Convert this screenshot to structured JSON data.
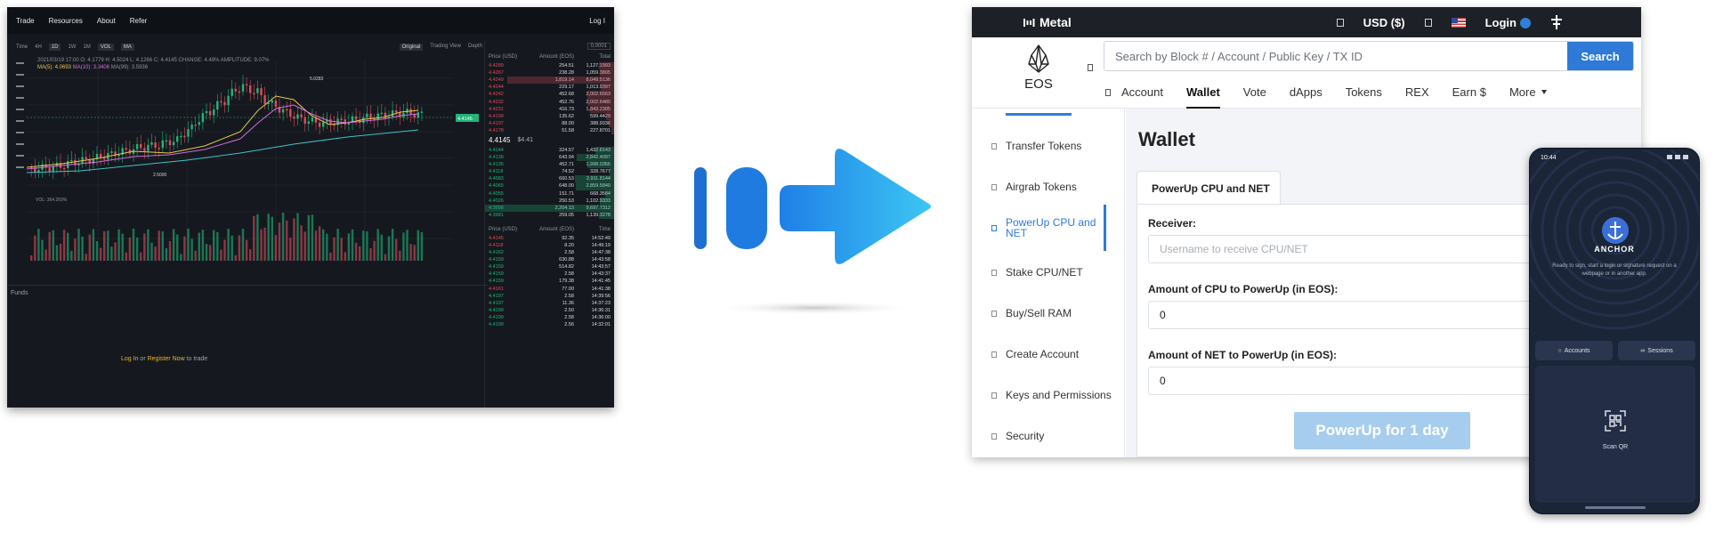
{
  "trade": {
    "nav": [
      "Trade",
      "Resources",
      "About",
      "Refer"
    ],
    "login": "Log I",
    "toolbar": {
      "intervals": [
        "Time",
        "4H",
        "1D",
        "1W",
        "1M"
      ],
      "active_interval": "1D",
      "indicators": [
        "VOL",
        "MA"
      ],
      "views": [
        "Original",
        "Trading View",
        "Depth"
      ]
    },
    "legend": {
      "ohlc": "2021/03/19 17:00  O: 4.1779  H: 4.5024  L: 4.1266  C: 4.4145  CHANGE: 4.49%  AMPLITUDE: 9.07%",
      "ma5": "MA(5): 4.0693",
      "ma10": "MA(10): 3.9406",
      "ma99": "MA(99): 3.5936"
    },
    "price_labels": {
      "high": "5.0283",
      "low": "2.5000",
      "last": "4.4145"
    },
    "vol_label": "VOL: 364.269%",
    "funds": "Funds",
    "login_message": {
      "login": "Log In",
      "or": "or",
      "register": "Register Now",
      "suffix": "to trade"
    },
    "book": {
      "step": "0.0001",
      "headers": [
        "Price (USD)",
        "Amount (EOS)",
        "Total"
      ],
      "sells": [
        {
          "p": "4.4289",
          "a": "254.51",
          "t": "1,127.1993"
        },
        {
          "p": "4.4267",
          "a": "238.28",
          "t": "1,059.3805"
        },
        {
          "p": "4.4249",
          "a": "1,819.14",
          "t": "8,049.5136"
        },
        {
          "p": "4.4244",
          "a": "229.17",
          "t": "1,013.9397"
        },
        {
          "p": "4.4242",
          "a": "452.68",
          "t": "2,002.6563"
        },
        {
          "p": "4.4232",
          "a": "452.76",
          "t": "2,002.6480"
        },
        {
          "p": "4.4231",
          "a": "416.73",
          "t": "1,843.2305"
        },
        {
          "p": "4.4199",
          "a": "135.62",
          "t": "599.4429"
        },
        {
          "p": "4.4197",
          "a": "88.00",
          "t": "388.9336"
        },
        {
          "p": "4.4178",
          "a": "51.58",
          "t": "227.8701"
        }
      ],
      "mid_price": "4.4145",
      "mid_usd": "$4.41",
      "buys": [
        {
          "p": "4.4144",
          "a": "324.57",
          "t": "1,432.8143"
        },
        {
          "p": "4.4139",
          "a": "643.94",
          "t": "2,842.4097"
        },
        {
          "p": "4.4135",
          "a": "452.71",
          "t": "1,998.0356"
        },
        {
          "p": "4.4118",
          "a": "74.52",
          "t": "328.7677"
        },
        {
          "p": "4.4083",
          "a": "660.53",
          "t": "2,911.8144"
        },
        {
          "p": "4.4065",
          "a": "648.00",
          "t": "2,859.5840"
        },
        {
          "p": "4.4055",
          "a": "151.71",
          "t": "668.3584"
        },
        {
          "p": "4.4026",
          "a": "250.53",
          "t": "1,102.9333"
        },
        {
          "p": "4.3998",
          "a": "2,204.13",
          "t": "9,697.7312"
        },
        {
          "p": "4.3981",
          "a": "259.05",
          "t": "1,139.3278"
        }
      ],
      "trade_headers": [
        "Price (USD)",
        "Amount (EOS)",
        "Time"
      ],
      "trades": [
        {
          "p": "4.4145",
          "a": "92.35",
          "t": "14:52:49",
          "s": "sell"
        },
        {
          "p": "4.4118",
          "a": "8.20",
          "t": "14:49:19",
          "s": "sell"
        },
        {
          "p": "4.4162",
          "a": "2.58",
          "t": "14:47:38",
          "s": "buy"
        },
        {
          "p": "4.4159",
          "a": "630.88",
          "t": "14:43:58",
          "s": "buy"
        },
        {
          "p": "4.4159",
          "a": "514.82",
          "t": "14:43:57",
          "s": "buy"
        },
        {
          "p": "4.4159",
          "a": "2.58",
          "t": "14:43:37",
          "s": "buy"
        },
        {
          "p": "4.4159",
          "a": "179.38",
          "t": "14:41:45",
          "s": "buy"
        },
        {
          "p": "4.4161",
          "a": "77.00",
          "t": "14:41:38",
          "s": "sell"
        },
        {
          "p": "4.4197",
          "a": "2.58",
          "t": "14:39:56",
          "s": "buy"
        },
        {
          "p": "4.4197",
          "a": "11.36",
          "t": "14:37:23",
          "s": "buy"
        },
        {
          "p": "4.4199",
          "a": "2.50",
          "t": "14:36:31",
          "s": "buy"
        },
        {
          "p": "4.4199",
          "a": "2.58",
          "t": "14:36:00",
          "s": "buy"
        },
        {
          "p": "4.4199",
          "a": "2.56",
          "t": "14:32:01",
          "s": "buy"
        }
      ]
    }
  },
  "metal": {
    "brand": "Metal",
    "currency": "USD ($)",
    "login": "Login",
    "eos_label": "EOS",
    "search": {
      "placeholder": "Search by Block # / Account / Public Key / TX ID",
      "button": "Search"
    },
    "tabs": [
      "Account",
      "Wallet",
      "Vote",
      "dApps",
      "Tokens",
      "REX",
      "Earn $",
      "More"
    ],
    "active_tab": "Wallet",
    "sidebar": [
      "Transfer Tokens",
      "Airgrab Tokens",
      "PowerUp CPU and NET",
      "Stake CPU/NET",
      "Buy/Sell RAM",
      "Create Account",
      "Keys and Permissions",
      "Security"
    ],
    "active_sidebar": "PowerUp CPU and NET",
    "page_title": "Wallet",
    "card_tab": "PowerUp CPU and NET",
    "receiver_label": "Receiver:",
    "receiver_placeholder": "Username to receive CPU/NET",
    "cpu_label": "Amount of CPU to PowerUp (in EOS):",
    "cpu_value": "0",
    "net_label": "Amount of NET to PowerUp (in EOS):",
    "net_value": "0",
    "submit": "PowerUp for 1 day"
  },
  "phone": {
    "time": "10:44",
    "title": "ANCHOR",
    "subtitle": "Ready to sign, start a login or signature request on a webpage or in another app.",
    "accounts": "Accounts",
    "sessions": "Sessions",
    "scan": "Scan QR"
  }
}
